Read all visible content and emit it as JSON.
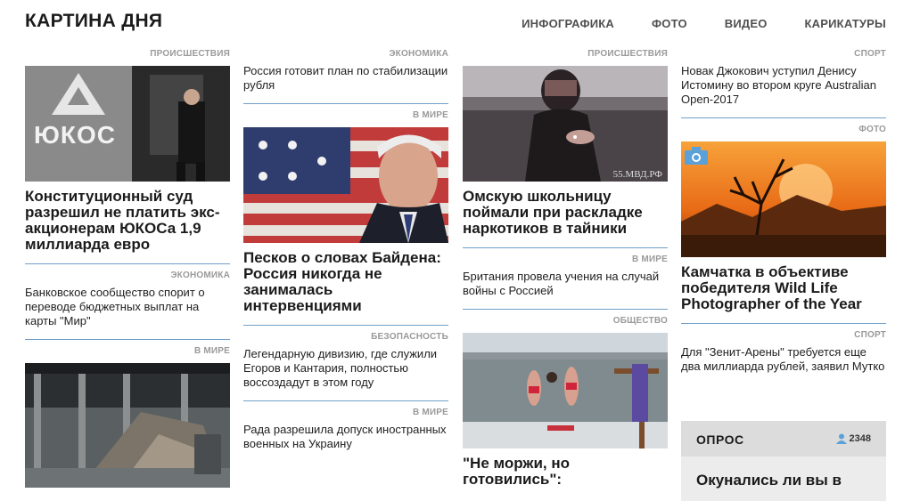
{
  "header": {
    "title": "КАРТИНА ДНЯ",
    "nav": [
      "ИНФОГРАФИКА",
      "ФОТО",
      "ВИДЕО",
      "КАРИКАТУРЫ"
    ]
  },
  "col1": {
    "a1_cat": "ПРОИСШЕСТВИЯ",
    "a1_img_text": "ЮКОС",
    "a1_title": "Конституционный суд разрешил не платить экс-акционерам ЮКОСа 1,9 миллиарда евро",
    "a2_cat": "ЭКОНОМИКА",
    "a2_title": "Банковское сообщество спорит о переводе бюджетных выплат на карты \"Мир\"",
    "a3_cat": "В МИРЕ"
  },
  "col2": {
    "a1_cat": "ЭКОНОМИКА",
    "a1_title": "Россия готовит план по стабилизации рубля",
    "a2_cat": "В МИРЕ",
    "a2_title": "Песков о словах Байдена: Россия никогда не занималась интервенциями",
    "a3_cat": "БЕЗОПАСНОСТЬ",
    "a3_title": "Легендарную дивизию, где служили Егоров и Кантария, полностью воссоздадут в этом году",
    "a4_cat": "В МИРЕ",
    "a4_title": "Рада разрешила допуск иностранных военных на Украину"
  },
  "col3": {
    "a1_cat": "ПРОИСШЕСТВИЯ",
    "a1_img_text": "55.МВД.РФ",
    "a1_title": "Омскую школьницу поймали при раскладке наркотиков в тайники",
    "a2_cat": "В МИРЕ",
    "a2_title": "Британия провела учения на случай войны с Россией",
    "a3_cat": "ОБЩЕСТВО",
    "a3_title": "\"Не моржи, но готовились\":"
  },
  "col4": {
    "a1_cat": "СПОРТ",
    "a1_title": "Новак Джокович уступил Денису Истомину во втором круге Australian Open-2017",
    "a2_cat": "ФОТО",
    "a2_title": "Камчатка в объективе победителя Wild Life Photographer of the Year",
    "a3_cat": "СПОРТ",
    "a3_title": "Для \"Зенит-Арены\" требуется еще два миллиарда рублей, заявил Мутко",
    "poll_title": "ОПРОС",
    "poll_count": "2348",
    "poll_question": "Окунались ли вы в"
  },
  "colors": {
    "accent_rule": "#6fa0c9",
    "category": "#9a9a9a",
    "poll_bg": "#ececec"
  }
}
